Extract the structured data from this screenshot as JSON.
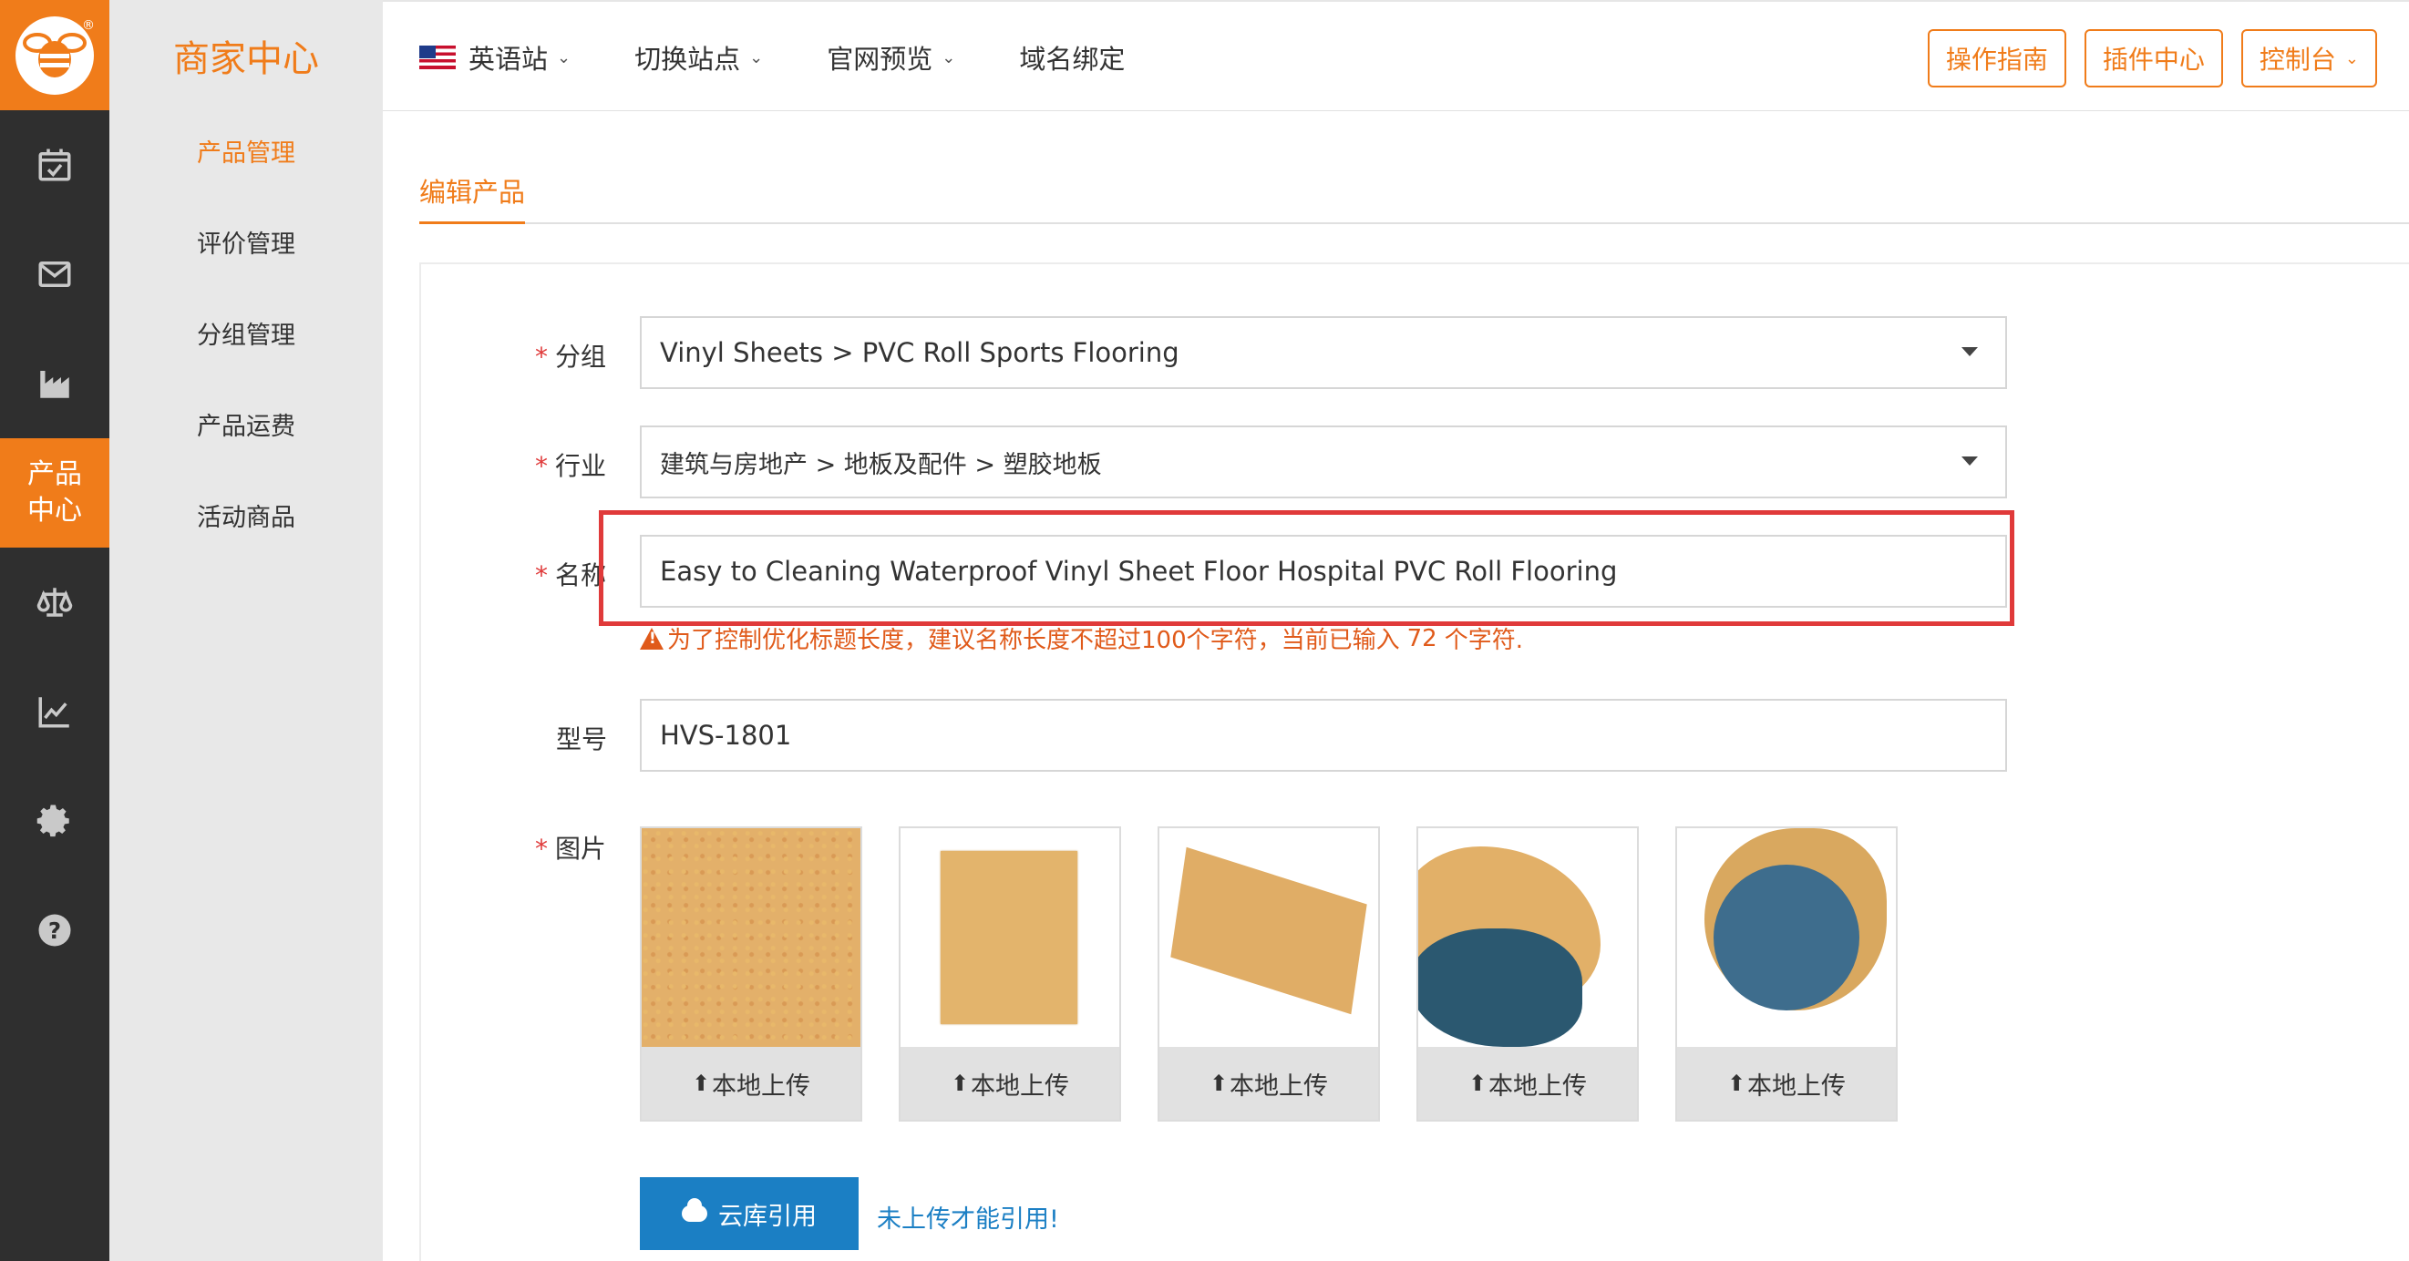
{
  "rail": {
    "active_label_line1": "产品",
    "active_label_line2": "中心"
  },
  "submenu": {
    "brand": "商家中心",
    "items": [
      {
        "label": "产品管理"
      },
      {
        "label": "评价管理"
      },
      {
        "label": "分组管理"
      },
      {
        "label": "产品运费"
      },
      {
        "label": "活动商品"
      }
    ]
  },
  "topbar": {
    "nav": [
      {
        "label": "英语站"
      },
      {
        "label": "切换站点"
      },
      {
        "label": "官网预览"
      },
      {
        "label": "域名绑定"
      }
    ],
    "buttons": {
      "guide": "操作指南",
      "plugins": "插件中心",
      "console": "控制台"
    }
  },
  "tab": {
    "label": "编辑产品"
  },
  "form": {
    "group": {
      "label": "分组",
      "value": "Vinyl Sheets > PVC Roll Sports Flooring"
    },
    "industry": {
      "label": "行业",
      "value": "建筑与房地产 > 地板及配件 > 塑胶地板"
    },
    "name": {
      "label": "名称",
      "value": "Easy to Cleaning Waterproof Vinyl Sheet Floor Hospital PVC Roll Flooring"
    },
    "hint": {
      "text": "为了控制优化标题长度，建议名称长度不超过100个字符，当前已输入",
      "count": "72",
      "suffix": "个字符."
    },
    "model": {
      "label": "型号",
      "value": "HVS-1801"
    },
    "images": {
      "label": "图片",
      "upload_label": "本地上传",
      "count": 5
    },
    "cloud_button": "云库引用",
    "cloud_note": "未上传才能引用!"
  },
  "colors": {
    "accent": "#f07c1a",
    "rail_bg": "#2f2f2f",
    "required": "#e03a3a",
    "link_blue": "#1b7fc4"
  }
}
